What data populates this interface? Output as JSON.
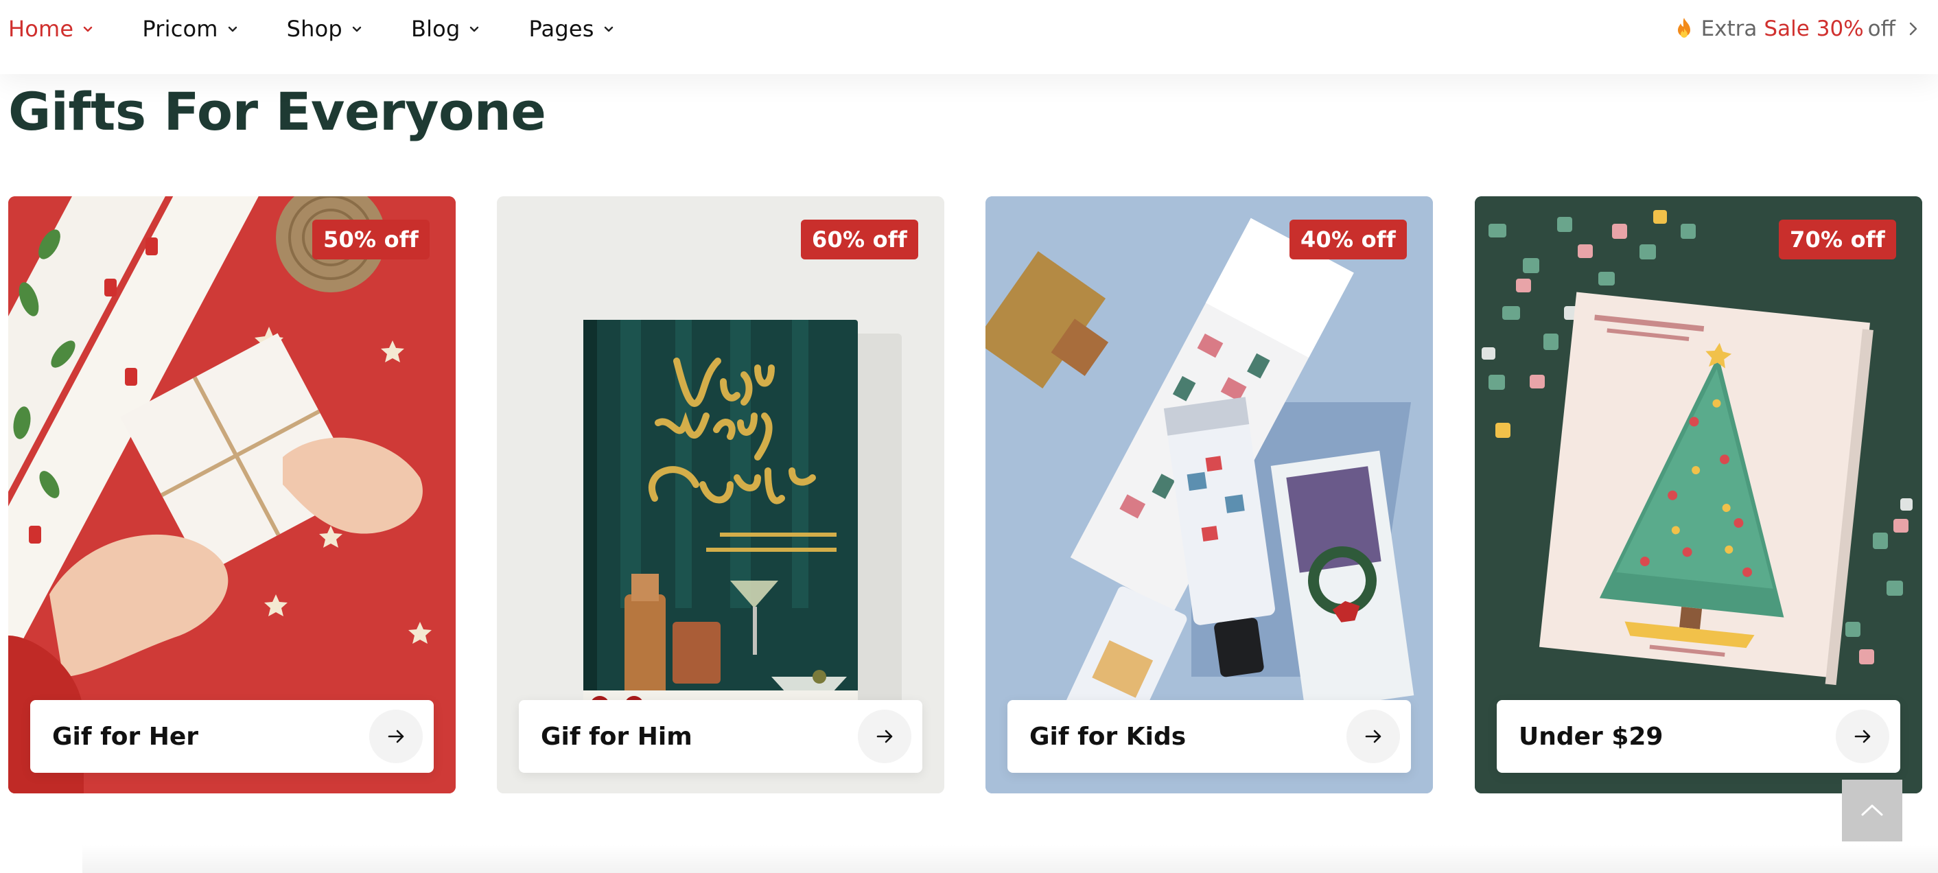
{
  "nav": {
    "items": [
      {
        "label": "Home",
        "active": true
      },
      {
        "label": "Pricom",
        "active": false
      },
      {
        "label": "Shop",
        "active": false
      },
      {
        "label": "Blog",
        "active": false
      },
      {
        "label": "Pages",
        "active": false
      }
    ]
  },
  "promo": {
    "icon": "flame-icon",
    "extra": "Extra",
    "sale": "Sale",
    "percent": "30%",
    "off": "off"
  },
  "section": {
    "title": "Gifts For Everyone"
  },
  "cards": [
    {
      "badge": "50% off",
      "title": "Gif for Her"
    },
    {
      "badge": "60% off",
      "title": "Gif for Him"
    },
    {
      "badge": "40% off",
      "title": "Gif for Kids"
    },
    {
      "badge": "70% off",
      "title": "Under $29"
    }
  ],
  "colors": {
    "accent_red": "#d0302e",
    "title_green": "#1e3a33",
    "badge_red": "#c92f2c"
  }
}
